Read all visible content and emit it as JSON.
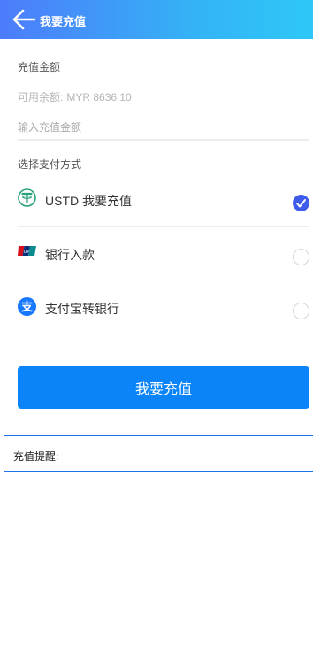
{
  "header": {
    "title": "我要充值",
    "back_icon": "arrow-left-icon"
  },
  "form": {
    "amount_label": "充值金额",
    "balance_label": "可用余额:",
    "balance_value": "MYR 8636.10",
    "amount_input": {
      "value": "",
      "placeholder": "输入充值金额"
    },
    "payment_label": "选择支付方式"
  },
  "payment_methods": [
    {
      "label": "USTD 我要充值",
      "icon": "tether-icon",
      "selected": true,
      "color": "#26a17b"
    },
    {
      "label": "银行入款",
      "icon": "unionpay-icon",
      "selected": false
    },
    {
      "label": "支付宝转银行",
      "icon": "alipay-icon",
      "selected": false,
      "color": "#1677ff"
    }
  ],
  "submit_label": "我要充值",
  "reminder_label": "充值提醒:",
  "colors": {
    "header_start": "#4d7cfb",
    "header_end": "#2ec7f7",
    "button": "#0a84f8",
    "radio_checked": "#3f5bea"
  }
}
